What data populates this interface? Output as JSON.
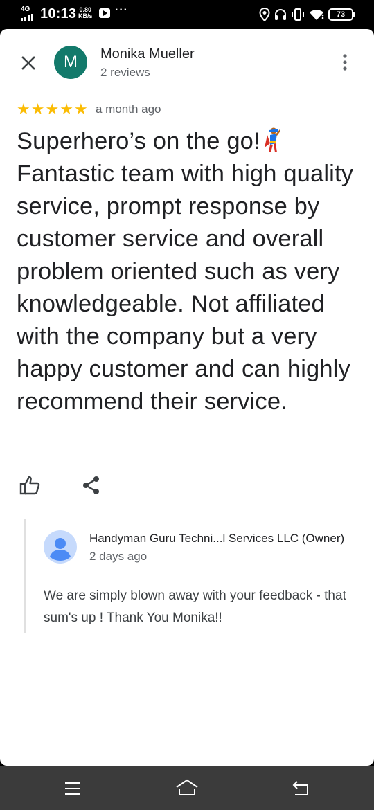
{
  "status_bar": {
    "network": "4G",
    "time": "10:13",
    "speed_value": "0.80",
    "speed_unit": "KB/s",
    "more": "···",
    "battery": "73"
  },
  "review": {
    "avatar_letter": "M",
    "avatar_color": "#137a6b",
    "reviewer_name": "Monika Mueller",
    "reviewer_reviews": "2 reviews",
    "rating": 5,
    "star_glyph": "★",
    "star_color": "#fbbc04",
    "date": "a month ago",
    "text": "Superhero’s on the go!",
    "text_rest": "Fantastic team with high quality service, prompt response by customer service and overall problem oriented such as very knowledgeable. Not affiliated with the company but a very happy customer and can highly recommend their service."
  },
  "owner_reply": {
    "name": "Handyman Guru Techni...l Services LLC (Owner)",
    "date": "2 days ago",
    "text": "We are simply blown away with your feedback - that sum's up ! Thank You Monika!!"
  },
  "icons": {
    "close": "close-icon",
    "more": "more-vert-icon",
    "like": "thumbs-up-icon",
    "share": "share-icon",
    "owner_avatar": "person-icon",
    "emoji": "superhero-emoji",
    "nav_menu": "recents-icon",
    "nav_home": "home-icon",
    "nav_back": "back-icon"
  }
}
